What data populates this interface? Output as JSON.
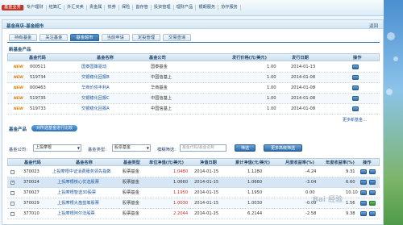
{
  "topnav": {
    "items": [
      "基金业务",
      "专户理财",
      "结算汇",
      "外汇买卖",
      "贵金属",
      "债券",
      "保险",
      "首存管",
      "投资管理",
      "理财产品",
      "银期服务",
      "协作服务"
    ]
  },
  "breadcrumb": "基金商店-基金超市",
  "back": "返回",
  "tabs": [
    "持有基金",
    "关注基金",
    "基金超市",
    "当前申请",
    "定投管理",
    "交易查询"
  ],
  "new_products": {
    "title": "新基金产品",
    "headers": [
      "基金代码",
      "基金名称",
      "基金公司",
      "发行价格(元/美元)",
      "发行日期",
      "操作"
    ],
    "rows": [
      {
        "tag": "NEW",
        "code": "000511",
        "name": "国泰国策驱动",
        "company": "国泰基金",
        "price": "1.00",
        "date": "2014-01-13"
      },
      {
        "tag": "NEW",
        "code": "519734",
        "name": "交银稳化回报B",
        "company": "中国信基上",
        "price": "1.00",
        "date": "2014-01-08"
      },
      {
        "tag": "NEW",
        "code": "000463",
        "name": "华商价债丰利A",
        "company": "华商基金",
        "price": "1.00",
        "date": "2014-01-08"
      },
      {
        "tag": "NEW",
        "code": "519735",
        "name": "交银稳化回报C",
        "company": "中国信基上",
        "price": "1.00",
        "date": "2014-01-08"
      },
      {
        "tag": "NEW",
        "code": "519733",
        "name": "交银稳化回报A",
        "company": "中国信基上",
        "price": "1.00",
        "date": "2014-01-08"
      }
    ],
    "more": "更多新基金..."
  },
  "products": {
    "title": "基金产品",
    "compare_pill": "对所选基金进行比较",
    "filter": {
      "company_label": "基金公司:",
      "company_value": "上投摩根",
      "type_label": "基金类型:",
      "type_value": "股票基金",
      "fuzzy_label": "模糊筛选:",
      "fuzzy_placeholder": "基金代码/基金名称",
      "search_btn": "筛选",
      "advanced_btn": "更多高级筛选"
    },
    "headers": [
      "基金代码",
      "基金名称",
      "基金类型",
      "单位净值(元/美元)",
      "净值日期",
      "累计净值(元/美元)",
      "月度收益率(%)",
      "年度收益率(%)",
      "操作"
    ],
    "rows": [
      {
        "code": "370023",
        "name": "上投摩根中证消费服务领先指数",
        "type": "股票基金",
        "nav": "1.0480",
        "nav_red": true,
        "date": "2014-01-15",
        "acc": "1.1280",
        "month": "-4.24",
        "year": "9.31",
        "checked": false
      },
      {
        "code": "370024",
        "name": "上投摩根核心优选股票",
        "type": "股票基金",
        "nav": "1.0660",
        "nav_red": false,
        "date": "2014-01-15",
        "acc": "1.0660",
        "month": "-3.04",
        "year": "6.60",
        "checked": true
      },
      {
        "code": "370027",
        "name": "上投摩根智选30股票",
        "type": "股票基金",
        "nav": "1.1950",
        "nav_red": true,
        "date": "2014-01-15",
        "acc": "1.1950",
        "month": "0.00",
        "year": "10.10",
        "checked": false
      },
      {
        "code": "370029",
        "name": "上投摩根大盘蓝筹股票",
        "type": "股票基金",
        "nav": "1.0030",
        "nav_red": true,
        "date": "2014-01-15",
        "acc": "1.0030",
        "month": "-0.09",
        "year": "1.56",
        "checked": false
      },
      {
        "code": "377010",
        "name": "上投摩根阿尔法股票",
        "type": "股票基金",
        "nav": "2.2044",
        "nav_red": true,
        "date": "2014-01-15",
        "acc": "6.2144",
        "month": "-2.58",
        "year": "9.38",
        "checked": false
      }
    ]
  },
  "watermark": "Bai 经验"
}
